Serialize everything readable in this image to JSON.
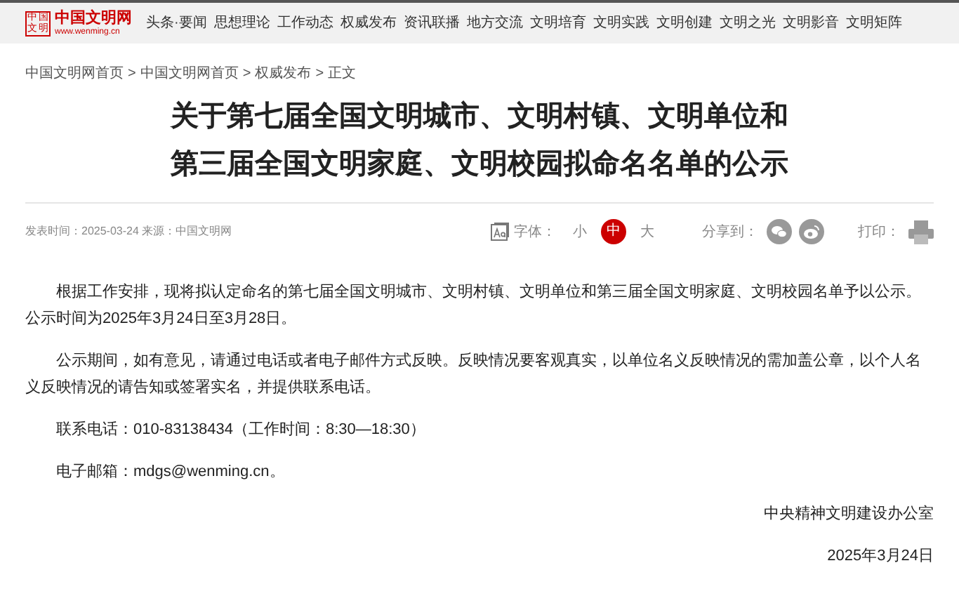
{
  "header": {
    "logo_title": "中国文明网",
    "logo_url": "www.wenming.cn",
    "logo_seal": "中国文明",
    "nav": [
      "头条·要闻",
      "思想理论",
      "工作动态",
      "权威发布",
      "资讯联播",
      "地方交流",
      "文明培育",
      "文明实践",
      "文明创建",
      "文明之光",
      "文明影音",
      "文明矩阵"
    ]
  },
  "breadcrumb": [
    "中国文明网首页",
    "中国文明网首页",
    "权威发布",
    "正文"
  ],
  "breadcrumb_separator": ">",
  "title": [
    "关于第七届全国文明城市、文明村镇、文明单位和",
    "第三届全国文明家庭、文明校园拟命名名单的公示"
  ],
  "meta": {
    "info": "发表时间：2025-03-24 来源：中国文明网",
    "font_label": "字体：",
    "font_sizes": [
      {
        "label": "小",
        "selected": false
      },
      {
        "label": "中",
        "selected": true
      },
      {
        "label": "大",
        "selected": false
      }
    ],
    "share_label": "分享到：",
    "print_label": "打印："
  },
  "paragraphs": [
    "根据工作安排，现将拟认定命名的第七届全国文明城市、文明村镇、文明单位和第三届全国文明家庭、文明校园名单予以公示。公示时间为2025年3月24日至3月28日。",
    "公示期间，如有意见，请通过电话或者电子邮件方式反映。反映情况要客观真实，以单位名义反映情况的需加盖公章，以个人名义反映情况的请告知或签署实名，并提供联系电话。",
    "联系电话：010-83138434（工作时间：8:30—18:30）",
    "电子邮箱：mdgs@wenming.cn。"
  ],
  "signature": "中央精神文明建设办公室",
  "date": "2025年3月24日"
}
